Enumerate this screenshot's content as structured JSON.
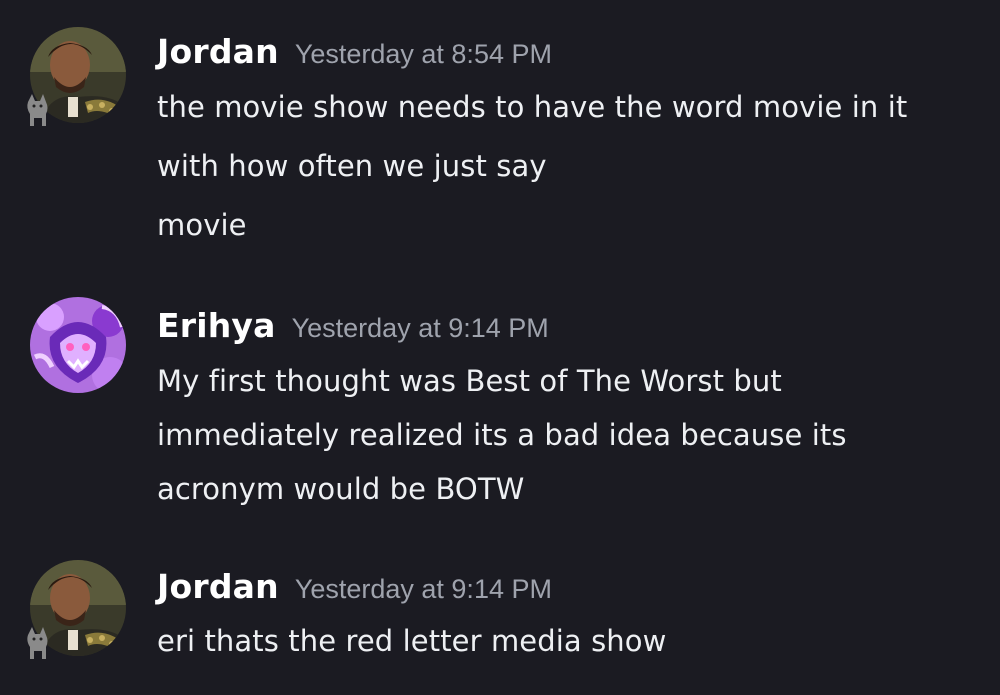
{
  "messages": [
    {
      "author": "Jordan",
      "timestamp": "Yesterday at 8:54 PM",
      "avatar_icon": "jordan-avatar-icon",
      "lines": [
        "the movie show needs to have the word movie in it",
        "with how often we just say",
        "movie"
      ]
    },
    {
      "author": "Erihya",
      "timestamp": "Yesterday at 9:14 PM",
      "avatar_icon": "erihya-avatar-icon",
      "lines": [
        "My first thought was Best of The Worst but",
        "immediately realized its a bad idea because its",
        "acronym would be BOTW"
      ]
    },
    {
      "author": "Jordan",
      "timestamp": "Yesterday at 9:14 PM",
      "avatar_icon": "jordan-avatar-icon",
      "lines": [
        "eri thats the red letter media show"
      ]
    }
  ],
  "colors": {
    "background": "#1b1b22",
    "username": "#ffffff",
    "timestamp": "#9fa3ad",
    "text": "#eef0f3"
  }
}
